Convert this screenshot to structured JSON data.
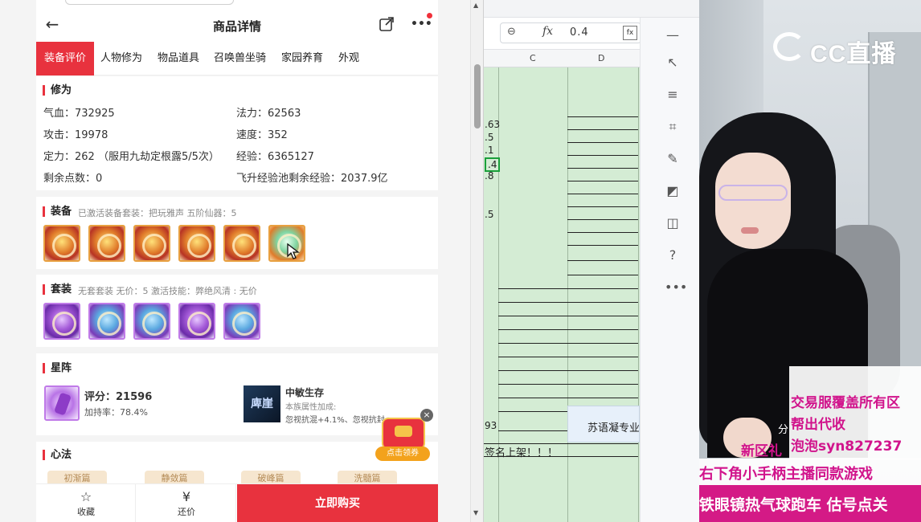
{
  "header": {
    "title": "商品详情"
  },
  "tabs": [
    {
      "label": "装备评价",
      "active": true
    },
    {
      "label": "人物修为"
    },
    {
      "label": "物品道具"
    },
    {
      "label": "召唤兽坐骑"
    },
    {
      "label": "家园养育"
    },
    {
      "label": "外观"
    }
  ],
  "xiuwei": {
    "title": "修为",
    "rows": [
      {
        "k": "气血：",
        "v": "732925"
      },
      {
        "k": "法力：",
        "v": "62563"
      },
      {
        "k": "攻击：",
        "v": "19978"
      },
      {
        "k": "速度：",
        "v": "352"
      },
      {
        "k": "定力：",
        "v": "262 （服用九劫定根露5/5次）"
      },
      {
        "k": "经验：",
        "v": "6365127"
      },
      {
        "k": "剩余点数：",
        "v": "0"
      },
      {
        "k": "飞升经验池剩余经验：",
        "v": "2037.9亿"
      }
    ]
  },
  "equip": {
    "title": "装备",
    "sub": "已激活装备套装：把玩雅声   五阶仙器：5"
  },
  "suit": {
    "title": "套装",
    "sub": "无套套装   无价：5   激活技能：弊绝风清 : 无价"
  },
  "star": {
    "title": "星阵",
    "score_label": "评分：",
    "score": "21596",
    "bonus_label": "加持率：",
    "bonus": "78.4%",
    "style_name": "中敏生存",
    "style_img_text": "庳崖",
    "style_sub": "本族属性加成:",
    "style_detail": "忽视抗混+4.1%、忽视抗封+4.1%"
  },
  "xinfa": {
    "title": "心法",
    "chips": [
      "初渐篇",
      "静敛篇",
      "破峰篇",
      "洗髓篇"
    ]
  },
  "gift": {
    "label": "点击领券",
    "close": "×"
  },
  "bottom": {
    "fav": "收藏",
    "bargain": "还价",
    "buy": "立即购买"
  },
  "sheet": {
    "formula_value": "0.4",
    "col_c": "C",
    "col_d": "D",
    "cells": [
      ".63",
      ".5",
      ".1",
      ".4",
      ".8",
      ".5",
      "93"
    ],
    "blue_cell": "苏语凝专业",
    "bottom_cell": "签名上架！！！"
  },
  "stream": {
    "logo": "CC直播",
    "lines": [
      "交易服覆盖所有区",
      "帮出代收",
      "泡泡syn827237",
      "新区礼",
      "右下角小手柄主播同款游戏",
      "铁眼镜热气球跑车  估号点关"
    ],
    "fen": "分"
  }
}
